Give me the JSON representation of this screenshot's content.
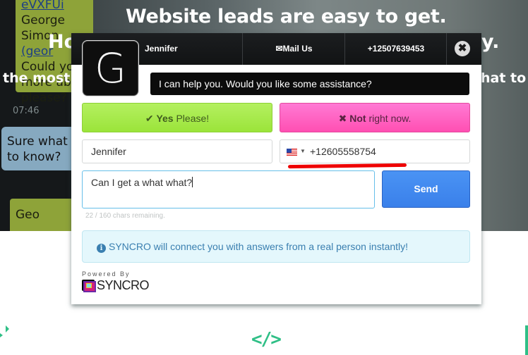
{
  "background": {
    "headline_1": "Website leads are easy to get.",
    "headline_2_left": "Ho",
    "headline_2_right": "y.",
    "headline_3_left": "the most r",
    "headline_3_right": "hat to t",
    "phone_chat": {
      "bubble1_link": "eVXFUi",
      "bubble1_name": "George Simon",
      "bubble1_email_prefix": "(geor",
      "bubble1_line3": "Could you",
      "bubble1_line4": "more abo",
      "bubble1_line5": "please?",
      "timestamp": "07:46",
      "bubble2_line1": "Sure what w",
      "bubble2_line2": "to know?",
      "bubble3_line1": "Geo"
    },
    "bottom_icon": "code-icon",
    "bottom_icon_glyph": "</>"
  },
  "widget": {
    "agent_name": "Jennifer",
    "avatar_letter": "G",
    "mail_label": "Mail Us",
    "mail_icon": "✉",
    "phone_number": "+12507639453",
    "close_icon": "✖",
    "greeting": "I can help you. Would you like some assistance?",
    "yes_button": {
      "icon": "✔",
      "bold": "Yes",
      "rest": " Please!"
    },
    "no_button": {
      "icon": "✖",
      "bold": "Not",
      "rest": " right now."
    },
    "name_field_value": "Jennifer",
    "phone_field": {
      "country": "US",
      "value": "+12605558754"
    },
    "message_value": "Can I get a what what?",
    "send_label": "Send",
    "chars_remaining": "22 / 160 chars remaining.",
    "info_text": "SYNCRO will connect you with answers from a real person instantly!",
    "info_icon": "i",
    "powered_by": "Powered By",
    "brand_name": "SYNCRO"
  },
  "colors": {
    "yes_green": "#a6ea48",
    "no_pink": "#ff5fbf",
    "send_blue": "#428bf0",
    "info_bg": "#e4f7fc",
    "info_text": "#3a7fb0",
    "accent_green": "#2fbf86"
  }
}
